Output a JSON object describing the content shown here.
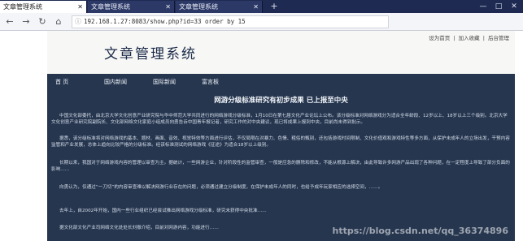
{
  "browser": {
    "tabs": [
      {
        "label": "文章管理系统",
        "active": true
      },
      {
        "label": "文章管理系统",
        "active": false
      },
      {
        "label": "文章管理系统",
        "active": false
      }
    ],
    "new_tab": "+",
    "url": "192.168.1.27:8083/show.php?id=33 order by 15",
    "window_controls": [
      "—",
      "□",
      "✕"
    ]
  },
  "site": {
    "top_links": [
      "设为首页",
      "|",
      "加入收藏",
      "|",
      "后台管理"
    ],
    "logo": "文章管理系统",
    "nav": [
      "首 页",
      "国内新闻",
      "国际新闻",
      "富言板"
    ]
  },
  "article": {
    "title": "网游分级标准研究有初步成果 已上报至中央",
    "paragraphs": [
      "中国文化部委托，由北京大学文化创意产业研究院与华中师范大学共同进行的网络游戏分级标准，1月10日在第七届文化产业论坛上公布。该分级标准对网络游戏分为适合全年龄段、12岁以上、18岁以上三个级别。北京大学文化创意产业研究院副院长、文化部网络文化家庭小组成员向勇告诉中国青年报记者，研究工作的对中央建议，现已将成果上报到中央，目前尚未得到批示。",
      "据悉，该分级标准将对网络游戏的基本、题材、画面、音效、视觉特效等方面进行评估，不仅局限在对暴力、色情、粗俗的甄别，还包括游戏时间限制、文化价值观和游戏特性等多方面，从保护未成年人的立场出发，干预内容监管和产业发展，总体上趋向比较严格的分级标准。经该标准测试的网络游戏《征途》为适合18岁以上级别。",
      "长期以来，我国对于网络游戏内容的管理以审查为主。据统计，一些网游企业，针对阶段性的监管审查，一般是应急的删除和修改，不能从根源上解决，由此导致许多网游产品出现了各种问题，在一定程度上导致了部分负面的影响……",
      "向勇认为，仅通过“一刀切”的内容审查难以解决网游行业存在的问题，必须通过建立分级制度，在保护未成年人的同时，也给予成年玩家相应的选择空间，……。",
      "去年上，自2002年开始，国内一些行业组织已经尝试推出网络游戏分级标准，研究未获得中央批准……",
      "据文化部文化产业司网络文化处处长刘振介绍，目前对网游内容，功能进行……"
    ]
  },
  "watermark": "https://blog.csdn.net/qq_36374896"
}
